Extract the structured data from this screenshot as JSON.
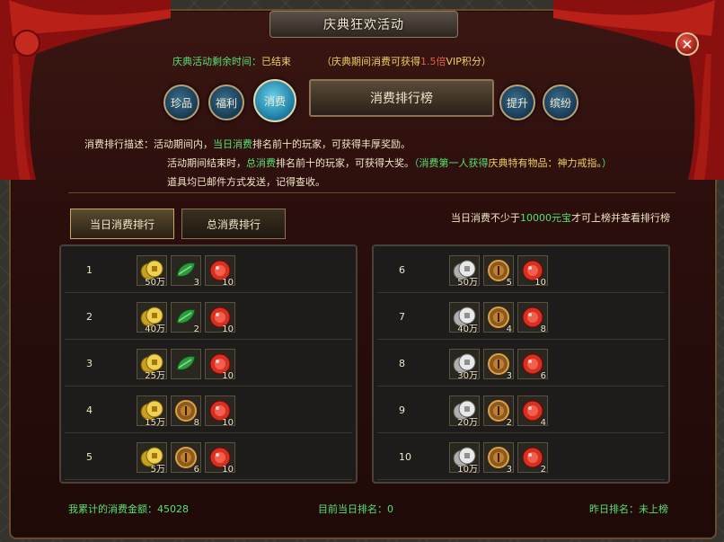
{
  "window": {
    "title": "庆典狂欢活动",
    "close": "✕"
  },
  "status": {
    "remaining_label": "庆典活动剩余时间：",
    "remaining_value": "已结束",
    "bonus_prefix": "（庆典期间消费可获得",
    "bonus_mult": "1.5倍",
    "bonus_suffix": "VIP积分）"
  },
  "nav": {
    "left": [
      "珍品",
      "福利",
      "消费"
    ],
    "right": [
      "提升",
      "缤纷"
    ],
    "active": "消费",
    "header": "消费排行榜"
  },
  "desc": {
    "l1_label": "消费排行描述：",
    "l1_a": "活动期间内，",
    "l1_g": "当日消费",
    "l1_b": "排名前十的玩家，可获得丰厚奖励。",
    "l2_a": "活动期间结束时，",
    "l2_g": "总消费",
    "l2_b": "排名前十的玩家，可获得大奖。",
    "l2_g2": "（消费第一人获得",
    "l2_c": "庆典特有物品：神力戒指。",
    "l2_g3": "）",
    "l3": "道具均已邮件方式发送，记得查收。"
  },
  "tabs": [
    "当日消费排行",
    "总消费排行"
  ],
  "notice": {
    "a": "当日消费不少于",
    "g": "10000元宝",
    "b": "才可上榜并查看排行榜"
  },
  "ranks": [
    {
      "rank": "1",
      "items": [
        {
          "icon": "gold-coin",
          "count": "50万"
        },
        {
          "icon": "green-leaf",
          "count": "3"
        },
        {
          "icon": "red-gem",
          "count": "10"
        }
      ]
    },
    {
      "rank": "2",
      "items": [
        {
          "icon": "gold-coin",
          "count": "40万"
        },
        {
          "icon": "green-leaf",
          "count": "2"
        },
        {
          "icon": "red-gem",
          "count": "10"
        }
      ]
    },
    {
      "rank": "3",
      "items": [
        {
          "icon": "gold-coin",
          "count": "25万"
        },
        {
          "icon": "green-leaf",
          "count": ""
        },
        {
          "icon": "red-gem",
          "count": "10"
        }
      ]
    },
    {
      "rank": "4",
      "items": [
        {
          "icon": "gold-coin",
          "count": "15万"
        },
        {
          "icon": "bronze-medal",
          "count": "8"
        },
        {
          "icon": "red-gem",
          "count": "10"
        }
      ]
    },
    {
      "rank": "5",
      "items": [
        {
          "icon": "gold-coin",
          "count": "5万"
        },
        {
          "icon": "bronze-medal",
          "count": "6"
        },
        {
          "icon": "red-gem",
          "count": "10"
        }
      ]
    },
    {
      "rank": "6",
      "items": [
        {
          "icon": "silver-coin",
          "count": "50万"
        },
        {
          "icon": "bronze-medal",
          "count": "5"
        },
        {
          "icon": "red-gem",
          "count": "10"
        }
      ]
    },
    {
      "rank": "7",
      "items": [
        {
          "icon": "silver-coin",
          "count": "40万"
        },
        {
          "icon": "bronze-medal",
          "count": "4"
        },
        {
          "icon": "red-gem",
          "count": "8"
        }
      ]
    },
    {
      "rank": "8",
      "items": [
        {
          "icon": "silver-coin",
          "count": "30万"
        },
        {
          "icon": "bronze-medal",
          "count": "3"
        },
        {
          "icon": "red-gem",
          "count": "6"
        }
      ]
    },
    {
      "rank": "9",
      "items": [
        {
          "icon": "silver-coin",
          "count": "20万"
        },
        {
          "icon": "bronze-medal",
          "count": "2"
        },
        {
          "icon": "red-gem",
          "count": "4"
        }
      ]
    },
    {
      "rank": "10",
      "items": [
        {
          "icon": "silver-coin",
          "count": "10万"
        },
        {
          "icon": "bronze-medal",
          "count": "3"
        },
        {
          "icon": "red-gem",
          "count": "2"
        }
      ]
    }
  ],
  "footer": {
    "total": "我累计的消费金额：45028",
    "today": "目前当日排名：0",
    "yesterday": "昨日排名：未上榜"
  }
}
